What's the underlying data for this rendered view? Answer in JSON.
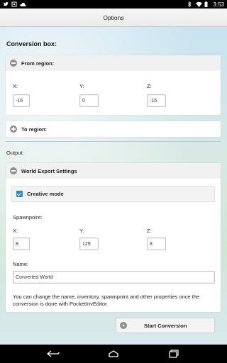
{
  "status_bar": {
    "time": "3:53",
    "left_icons": [
      "twitter-icon",
      "notification-icon",
      "cloud-icon"
    ],
    "right_icons": [
      "bluetooth-icon",
      "wifi-icon",
      "battery-icon"
    ]
  },
  "header": {
    "title": "Options"
  },
  "conversion_box": {
    "title": "Conversion box:",
    "from_region": {
      "label": "From region:",
      "x_label": "X:",
      "x_value": "-16",
      "y_label": "Y:",
      "y_value": "0",
      "z_label": "Z:",
      "z_value": "-16"
    },
    "to_region": {
      "label": "To region:"
    }
  },
  "output": {
    "title": "Output:",
    "world_export": {
      "label": "World Export Settings",
      "creative_mode_label": "Creative mode",
      "creative_mode_checked": true,
      "spawnpoint_label": "Spawnpoint:",
      "x_label": "X:",
      "x_value": "8",
      "y_label": "Y:",
      "y_value": "129",
      "z_label": "Z:",
      "z_value": "8",
      "name_label": "Name:",
      "name_value": "Converted World",
      "info_text": "You can change the name, inventory, spawnpoint and other properties once the conversion is done with PocketInvEditor."
    }
  },
  "start_button_label": "Start Conversion",
  "nav_bar": {
    "buttons": [
      "back-icon",
      "home-icon",
      "recents-icon"
    ]
  },
  "colors": {
    "accent": "#2f86c8",
    "icon_gray": "#8d8d8d"
  }
}
